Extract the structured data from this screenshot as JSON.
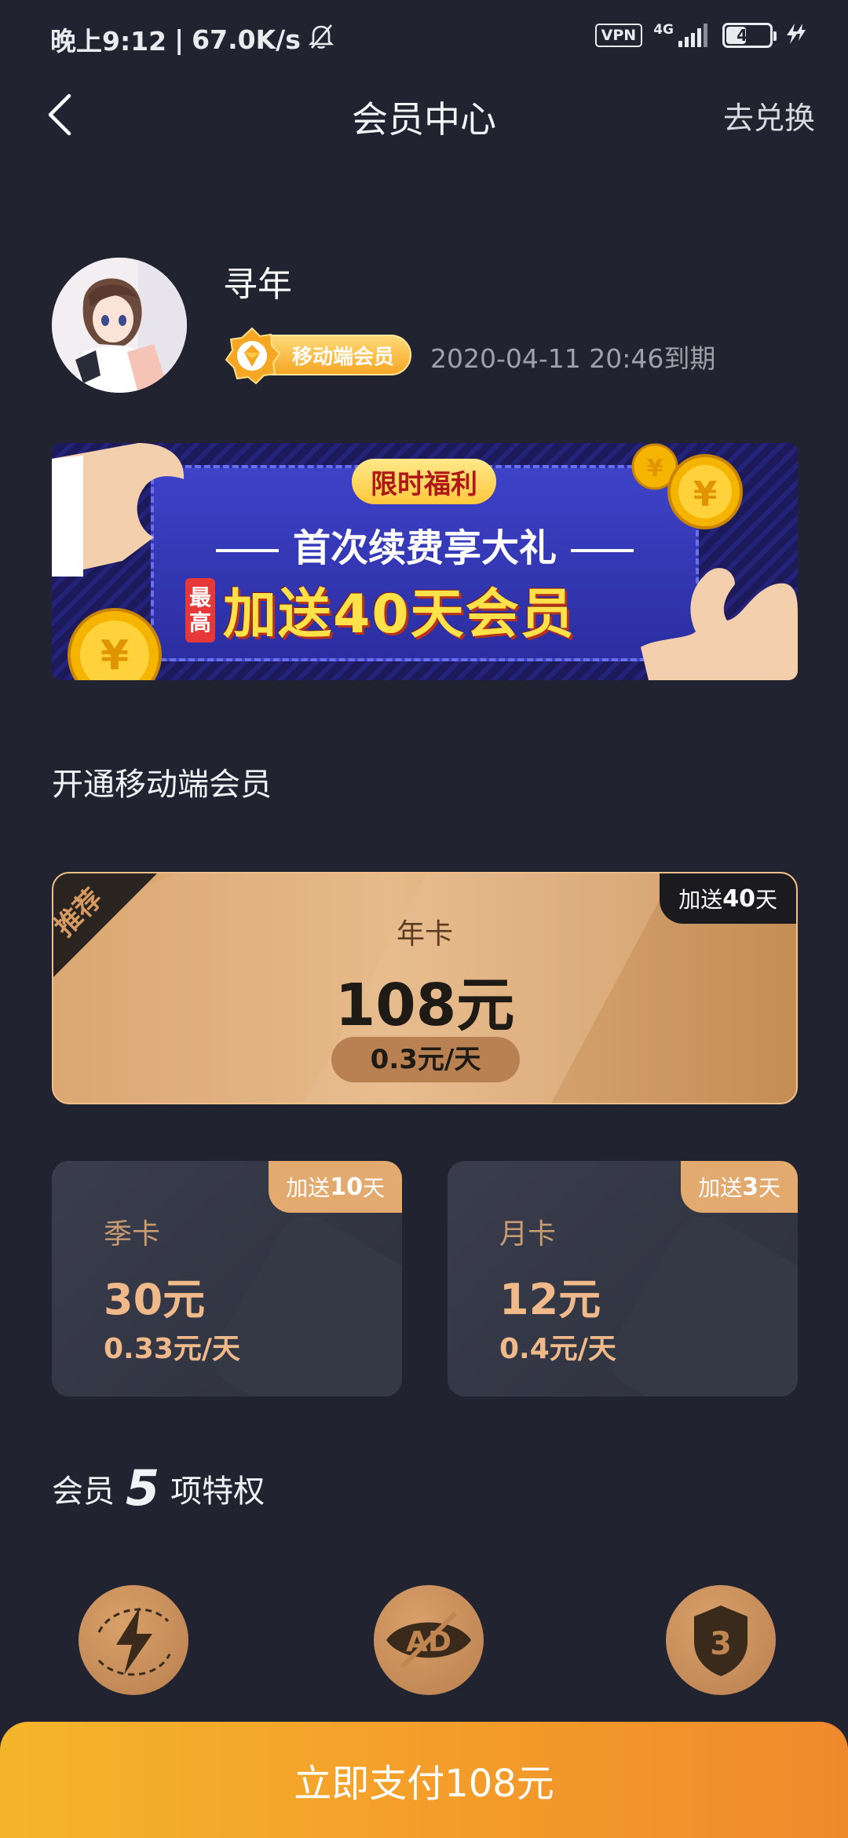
{
  "status_bar": {
    "time": "晚上9:12",
    "net_speed": "67.0K/s",
    "vpn": "VPN",
    "network": "4G",
    "battery": "46",
    "battery_level": 0.46
  },
  "header": {
    "title": "会员中心",
    "redeem": "去兑换"
  },
  "profile": {
    "username": "寻年",
    "badge": "移动端会员",
    "expiry": "2020-04-11 20:46到期"
  },
  "banner": {
    "tag": "限时福利",
    "line1": "首次续费享大礼",
    "max_top": "最",
    "max_bottom": "高",
    "line2": "加送40天会员"
  },
  "section_title": "开通移动端会员",
  "year_card": {
    "corner": "推荐",
    "extra_prefix": "加送",
    "extra_days": "40",
    "extra_suffix": "天",
    "name": "年卡",
    "price": "108元",
    "daily": "0.3元/天"
  },
  "season_card": {
    "extra_prefix": "加送",
    "extra_days": "10",
    "extra_suffix": "天",
    "name": "季卡",
    "price": "30元",
    "daily": "0.33元/天"
  },
  "month_card": {
    "extra_prefix": "加送",
    "extra_days": "3",
    "extra_suffix": "天",
    "name": "月卡",
    "price": "12元",
    "daily": "0.4元/天"
  },
  "privileges": {
    "prefix": "会员",
    "count": "5",
    "suffix": "项特权",
    "icons": [
      "lightning-icon",
      "no-ad-icon",
      "shield-3-icon"
    ],
    "ad_text": "AD",
    "shield_number": "3"
  },
  "pay_button": "立即支付108元",
  "colors": {
    "background": "#212430",
    "accent_gold": "#e3aa6f",
    "pay_gradient_start": "#f5b52b",
    "pay_gradient_end": "#ef8a2c"
  }
}
